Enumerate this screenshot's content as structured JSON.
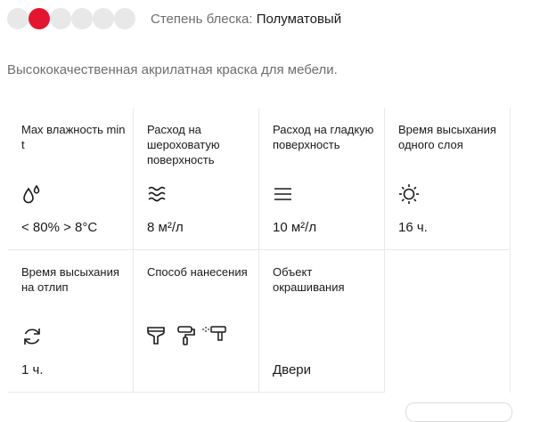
{
  "gloss": {
    "label": "Степень блеска:",
    "value": "Полуматовый",
    "levels_total": 6,
    "selected_level": 2,
    "active_color": "#e4152f",
    "inactive_color": "#e8e8e8"
  },
  "description": "Высококачественная акрилатная краска для мебели.",
  "specs": [
    {
      "label": "Max влажность min t",
      "icon": "droplets-icon",
      "value": "< 80% > 8°C"
    },
    {
      "label": "Расход на шероховатую поверхность",
      "icon": "rough-surface-icon",
      "value": "8 м²/л"
    },
    {
      "label": "Расход на гладкую поверхность",
      "icon": "smooth-surface-icon",
      "value": "10 м²/л"
    },
    {
      "label": "Время высыхания одного слоя",
      "icon": "sun-icon",
      "value": "16 ч."
    },
    {
      "label": "Время высыхания на отлип",
      "icon": "refresh-icon",
      "value": "1 ч."
    },
    {
      "label": "Способ нанесения",
      "icons": [
        "brush-icon",
        "roller-icon",
        "spray-gun-icon"
      ]
    },
    {
      "label": "Объект окрашивания",
      "value": "Двери"
    }
  ]
}
